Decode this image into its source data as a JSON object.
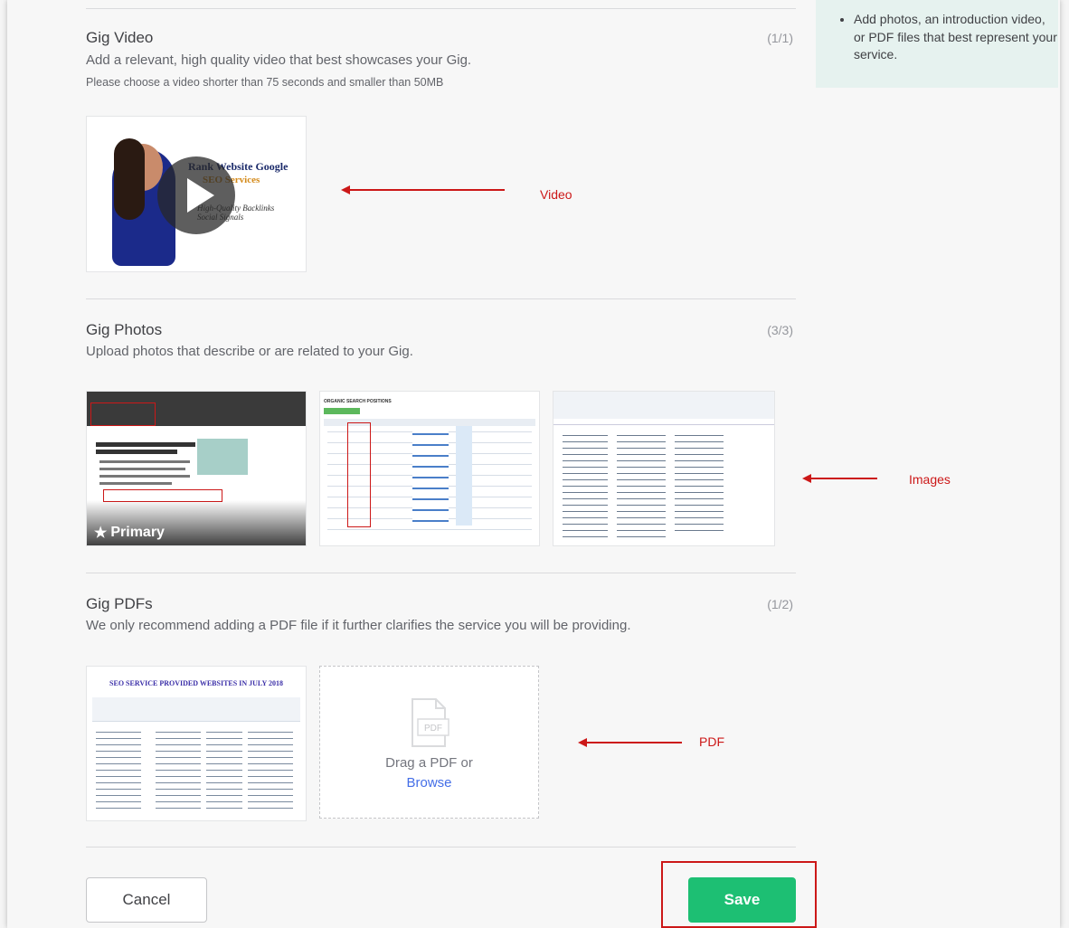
{
  "tip": {
    "text": "Add photos, an introduction video, or PDF files that best represent your service."
  },
  "video": {
    "title": "Gig Video",
    "count": "(1/1)",
    "description": "Add a relevant, high quality video that best showcases your Gig.",
    "note": "Please choose a video shorter than 75 seconds and smaller than 50MB",
    "thumb_text_line1": "Rank Website Google",
    "thumb_text_line2": "SEO Services",
    "thumb_text_line3": "High-Quality Backlinks",
    "thumb_text_line4": "Social Signals"
  },
  "photos": {
    "title": "Gig Photos",
    "count": "(3/3)",
    "description": "Upload photos that describe or are related to your Gig.",
    "primary_label": "Primary",
    "thumb2_header": "ORGANIC SEARCH POSITIONS"
  },
  "pdfs": {
    "title": "Gig PDFs",
    "count": "(1/2)",
    "description": "We only recommend adding a PDF file if it further clarifies the service you will be providing.",
    "thumb_title": "SEO SERVICE PROVIDED WEBSITES IN JULY 2018",
    "drop_text": "Drag a PDF or",
    "browse_link": "Browse",
    "pdf_icon_text": "PDF"
  },
  "annotations": {
    "video": "Video",
    "images": "Images",
    "pdf": "PDF"
  },
  "footer": {
    "cancel_label": "Cancel",
    "save_label": "Save"
  },
  "colors": {
    "accent": "#1dbf73",
    "annotation": "#cc1818",
    "tip_bg": "#e6f2ef"
  },
  "icons": [
    "play-icon",
    "star-icon",
    "pdf-file-icon",
    "red-arrow-icon"
  ]
}
